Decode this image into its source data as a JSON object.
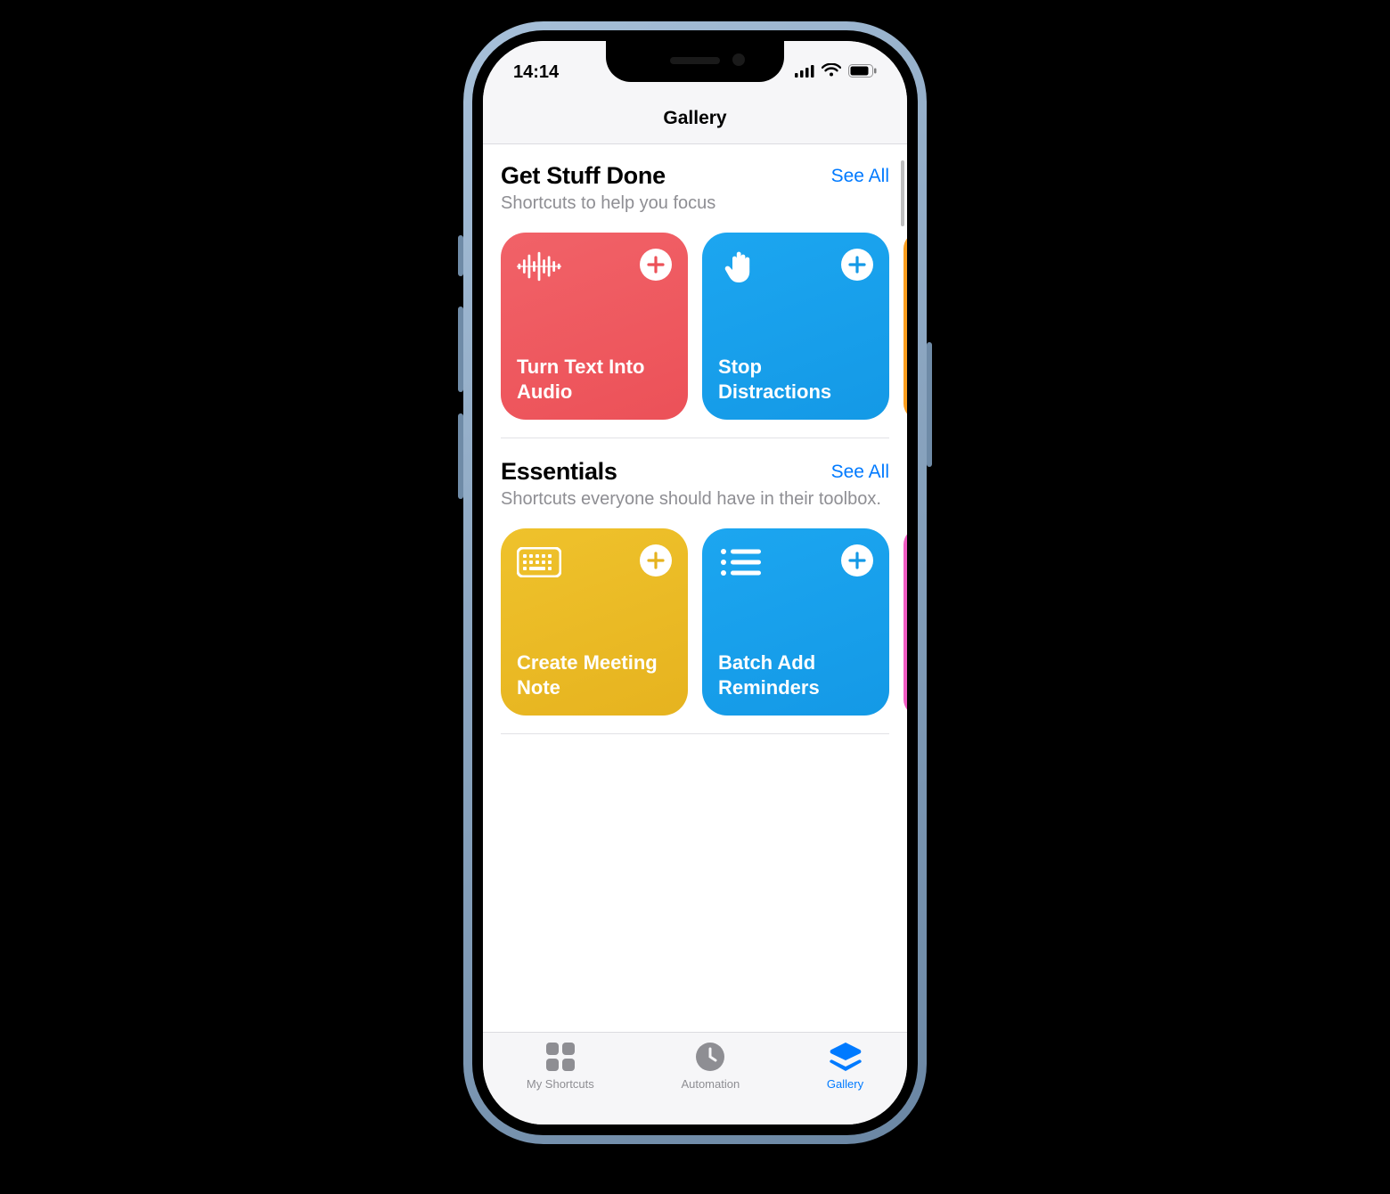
{
  "status_bar": {
    "time": "14:14"
  },
  "nav": {
    "title": "Gallery"
  },
  "link_labels": {
    "see_all": "See All"
  },
  "colors": {
    "tint": "#007aff",
    "secondary_text": "#8e8e93"
  },
  "sections": [
    {
      "title": "Get Stuff Done",
      "subtitle": "Shortcuts to help you focus",
      "cards": [
        {
          "icon": "waveform-icon",
          "title": "Turn Text Into Audio",
          "color": "red"
        },
        {
          "icon": "hand-icon",
          "title": "Stop Distractions",
          "color": "blue"
        }
      ],
      "peek_color": "orange"
    },
    {
      "title": "Essentials",
      "subtitle": "Shortcuts everyone should have in their toolbox.",
      "cards": [
        {
          "icon": "keyboard-icon",
          "title": "Create Meeting Note",
          "color": "yellow"
        },
        {
          "icon": "list-icon",
          "title": "Batch Add Reminders",
          "color": "blue2"
        }
      ],
      "peek_color": "pink"
    }
  ],
  "tabs": [
    {
      "icon": "grid-icon",
      "label": "My Shortcuts"
    },
    {
      "icon": "clock-icon",
      "label": "Automation"
    },
    {
      "icon": "stack-icon",
      "label": "Gallery"
    }
  ],
  "active_tab_index": 2
}
